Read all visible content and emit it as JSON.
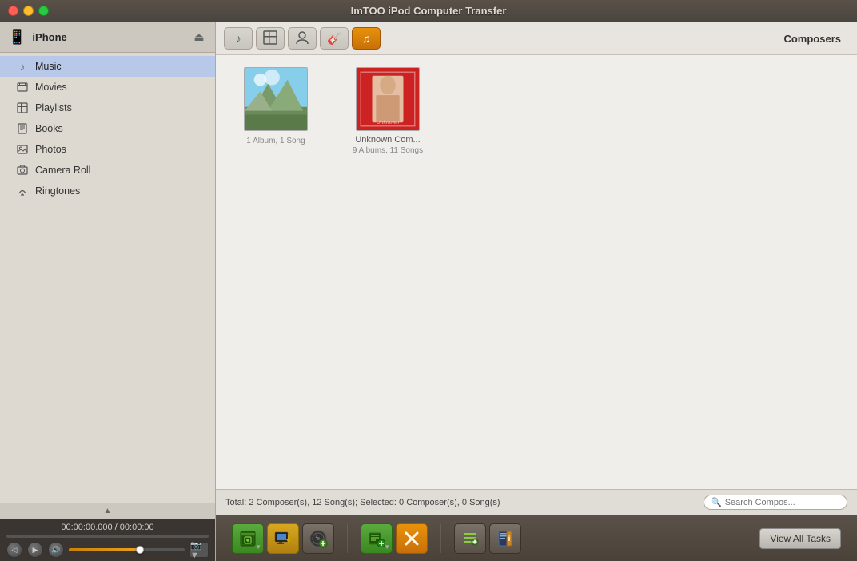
{
  "app": {
    "title": "ImTOO iPod Computer Transfer"
  },
  "window_controls": {
    "close": "close",
    "minimize": "minimize",
    "maximize": "maximize"
  },
  "sidebar": {
    "device_name": "iPhone",
    "items": [
      {
        "id": "music",
        "label": "Music",
        "icon": "♪",
        "active": true
      },
      {
        "id": "movies",
        "label": "Movies",
        "icon": "▪",
        "active": false
      },
      {
        "id": "playlists",
        "label": "Playlists",
        "icon": "▦",
        "active": false
      },
      {
        "id": "books",
        "label": "Books",
        "icon": "▪",
        "active": false
      },
      {
        "id": "photos",
        "label": "Photos",
        "icon": "▪",
        "active": false
      },
      {
        "id": "camera-roll",
        "label": "Camera Roll",
        "icon": "▪",
        "active": false
      },
      {
        "id": "ringtones",
        "label": "Ringtones",
        "icon": "♩",
        "active": false
      }
    ]
  },
  "player": {
    "time_current": "00:00:00.000",
    "time_total": "00:00:00",
    "time_display": "00:00:00.000 / 00:00:00"
  },
  "tabs": [
    {
      "id": "songs",
      "icon": "♪",
      "active": false
    },
    {
      "id": "albums",
      "icon": "▦",
      "active": false
    },
    {
      "id": "artists",
      "icon": "👤",
      "active": false
    },
    {
      "id": "genres",
      "icon": "🎸",
      "active": false
    },
    {
      "id": "composers",
      "icon": "♫",
      "active": true
    }
  ],
  "content": {
    "section_title": "Composers",
    "composers": [
      {
        "id": "composer-1",
        "name": "",
        "albums": "1 Album, 1 Song",
        "type": "landscape"
      },
      {
        "id": "composer-2",
        "name": "Unknown Com...",
        "albums": "9 Albums, 11 Songs",
        "type": "portrait"
      }
    ]
  },
  "status_bar": {
    "total_text": "Total: 2 Composer(s), 12 Song(s); Selected: 0 Composer(s), 0 Song(s)",
    "search_placeholder": "Search Compos..."
  },
  "toolbar": {
    "buttons": [
      {
        "id": "add-to-device",
        "type": "green",
        "icon": "⊕",
        "has_dropdown": true
      },
      {
        "id": "transfer-to-computer",
        "type": "yellow",
        "icon": "⬇"
      },
      {
        "id": "add-music",
        "type": "normal",
        "icon": "⊕"
      },
      {
        "id": "add-playlist",
        "type": "green",
        "icon": "≡",
        "has_dropdown": true
      },
      {
        "id": "delete",
        "type": "orange",
        "icon": "✕"
      },
      {
        "id": "playlist-manager",
        "type": "normal",
        "icon": "≡"
      },
      {
        "id": "info",
        "type": "normal",
        "icon": "ℹ"
      }
    ],
    "view_all_tasks_label": "View All Tasks"
  }
}
